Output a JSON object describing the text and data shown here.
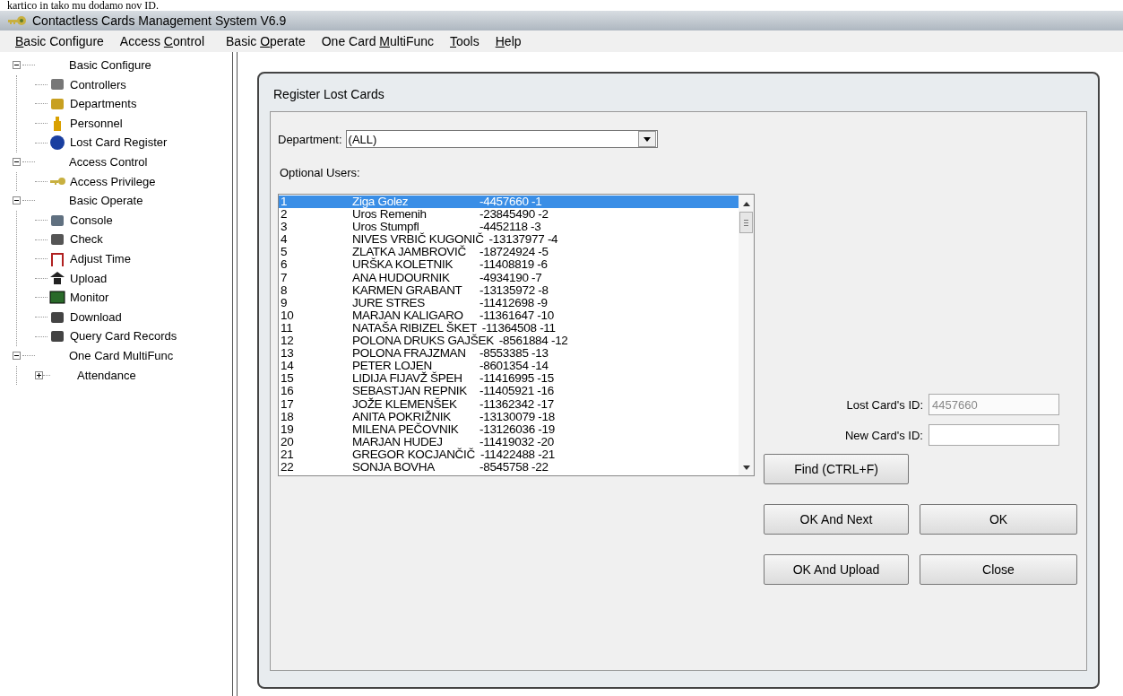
{
  "document_caption": "kartico in tako mu dodamo nov ID.",
  "window": {
    "title": "Contactless Cards Management System  V6.9"
  },
  "menu": [
    {
      "key": "B",
      "post": "asic Configure"
    },
    {
      "pre": "Access ",
      "key": "C",
      "post": "ontrol"
    },
    {
      "pre": "Basic ",
      "key": "O",
      "post": "perate"
    },
    {
      "pre": "One Card ",
      "key": "M",
      "post": "ultiFunc"
    },
    {
      "key": "T",
      "post": "ools"
    },
    {
      "key": "H",
      "post": "elp"
    }
  ],
  "tree": [
    {
      "label": "Basic Configure",
      "expanded": true,
      "children": [
        {
          "label": "Controllers",
          "kind": "controllers"
        },
        {
          "label": "Departments",
          "kind": "departments"
        },
        {
          "label": "Personnel",
          "kind": "personnel"
        },
        {
          "label": "Lost Card Register",
          "kind": "info"
        }
      ]
    },
    {
      "label": "Access Control",
      "expanded": true,
      "children": [
        {
          "label": "Access Privilege",
          "kind": "key"
        }
      ]
    },
    {
      "label": "Basic Operate",
      "expanded": true,
      "children": [
        {
          "label": "Console",
          "kind": "console"
        },
        {
          "label": "Check",
          "kind": "check"
        },
        {
          "label": "Adjust Time",
          "kind": "time"
        },
        {
          "label": "Upload",
          "kind": "upload"
        },
        {
          "label": "Monitor",
          "kind": "monitor"
        },
        {
          "label": "Download",
          "kind": "download"
        },
        {
          "label": "Query Card Records",
          "kind": "query"
        }
      ]
    },
    {
      "label": "One Card MultiFunc",
      "expanded": true,
      "children": [
        {
          "label": "Attendance",
          "kind": "folder",
          "expanded": false
        }
      ]
    }
  ],
  "dialog": {
    "title": "Register Lost Cards",
    "department": {
      "label": "Department:",
      "value": "(ALL)"
    },
    "users_label": "Optional Users:",
    "users": [
      {
        "no": "1",
        "name": "Ziga Golez",
        "code": "-4457660 -1",
        "selected": true
      },
      {
        "no": "2",
        "name": "Uros Remenih",
        "code": "-23845490 -2",
        "selected": false
      },
      {
        "no": "3",
        "name": "Uros Stumpfl",
        "code": "-4452118 -3",
        "selected": false
      },
      {
        "no": "4",
        "name": "NIVES VRBIČ KUGONIČ",
        "code": "-13137977 -4",
        "selected": false
      },
      {
        "no": "5",
        "name": "ZLATKA JAMBROVIČ",
        "code": "-18724924 -5",
        "selected": false
      },
      {
        "no": "6",
        "name": "URŠKA KOLETNIK",
        "code": "-11408819 -6",
        "selected": false
      },
      {
        "no": "7",
        "name": "ANA HUDOURNIK",
        "code": "-4934190 -7",
        "selected": false
      },
      {
        "no": "8",
        "name": "KARMEN GRABANT",
        "code": "-13135972 -8",
        "selected": false
      },
      {
        "no": "9",
        "name": "JURE STRES",
        "code": "-11412698 -9",
        "selected": false
      },
      {
        "no": "10",
        "name": "MARJAN KALIGARO",
        "code": "-11361647 -10",
        "selected": false
      },
      {
        "no": "11",
        "name": "NATAŠA RIBIZEL ŠKET",
        "code": "-11364508 -11",
        "selected": false
      },
      {
        "no": "12",
        "name": "POLONA DRUKS GAJŠEK",
        "code": "-8561884 -12",
        "selected": false
      },
      {
        "no": "13",
        "name": "POLONA FRAJZMAN",
        "code": "-8553385 -13",
        "selected": false
      },
      {
        "no": "14",
        "name": "PETER LOJEN",
        "code": "-8601354 -14",
        "selected": false
      },
      {
        "no": "15",
        "name": "LIDIJA FIJAVŽ ŠPEH",
        "code": "-11416995 -15",
        "selected": false
      },
      {
        "no": "16",
        "name": "SEBASTJAN REPNIK",
        "code": "-11405921 -16",
        "selected": false
      },
      {
        "no": "17",
        "name": "JOŽE KLEMENŠEK",
        "code": "-11362342 -17",
        "selected": false
      },
      {
        "no": "18",
        "name": "ANITA POKRIŽNIK",
        "code": "-13130079 -18",
        "selected": false
      },
      {
        "no": "19",
        "name": "MILENA PEČOVNIK",
        "code": "-13126036 -19",
        "selected": false
      },
      {
        "no": "20",
        "name": "MARJAN HUDEJ",
        "code": "-11419032 -20",
        "selected": false
      },
      {
        "no": "21",
        "name": "GREGOR KOCJANČIČ",
        "code": "-11422488 -21",
        "selected": false
      },
      {
        "no": "22",
        "name": "SONJA BOVHA",
        "code": "-8545758 -22",
        "selected": false
      }
    ],
    "lost_id": {
      "label": "Lost Card's ID:",
      "value": "4457660",
      "disabled": true
    },
    "new_id": {
      "label": "New Card's ID:"
    },
    "find_button": "Find  (CTRL+F)",
    "buttons": [
      [
        "OK And Next",
        "OK"
      ],
      [
        "OK And Upload",
        "Close"
      ]
    ]
  }
}
